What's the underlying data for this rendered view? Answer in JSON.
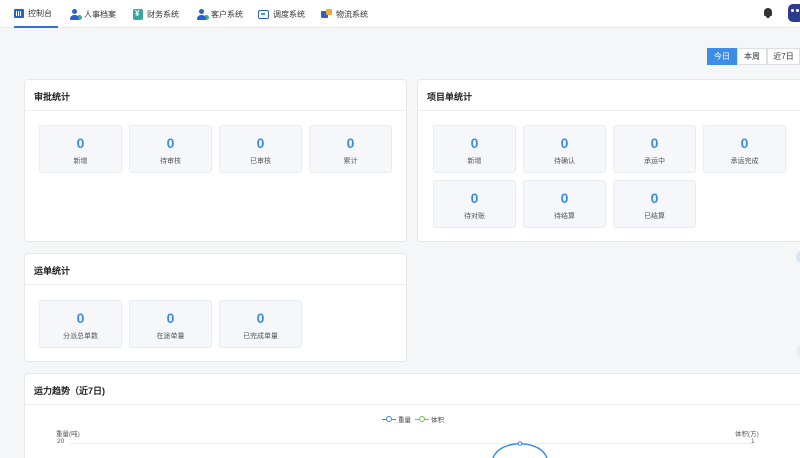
{
  "nav": {
    "items": [
      {
        "label": "控制台",
        "icon": "dashboard-icon"
      },
      {
        "label": "人事档案",
        "icon": "person-icon"
      },
      {
        "label": "财务系统",
        "icon": "finance-icon"
      },
      {
        "label": "客户系统",
        "icon": "customer-icon"
      },
      {
        "label": "调度系统",
        "icon": "monitor-icon"
      },
      {
        "label": "物流系统",
        "icon": "logistics-icon"
      }
    ],
    "active_index": 0,
    "accent": "#2f6fd6"
  },
  "date_range": {
    "options": [
      "今日",
      "本周",
      "近7日"
    ],
    "selected": "今日",
    "accent": "#3d8ce8"
  },
  "approval": {
    "title": "审批统计",
    "stats": [
      {
        "value": "0",
        "label": "新增"
      },
      {
        "value": "0",
        "label": "待审核"
      },
      {
        "value": "0",
        "label": "已审核"
      },
      {
        "value": "0",
        "label": "累计"
      }
    ]
  },
  "project": {
    "title": "项目单统计",
    "stats": [
      {
        "value": "0",
        "label": "新增"
      },
      {
        "value": "0",
        "label": "待确认"
      },
      {
        "value": "0",
        "label": "承运中"
      },
      {
        "value": "0",
        "label": "承运完成"
      },
      {
        "value": "0",
        "label": "待对账"
      },
      {
        "value": "0",
        "label": "待结算"
      },
      {
        "value": "0",
        "label": "已结算"
      }
    ]
  },
  "waybill": {
    "title": "运单统计",
    "stats": [
      {
        "value": "0",
        "label": "分派总单数"
      },
      {
        "value": "0",
        "label": "在途单量"
      },
      {
        "value": "0",
        "label": "已完成单量"
      }
    ]
  },
  "trend": {
    "title": "运力趋势（近7日)",
    "chart_data": {
      "type": "line",
      "series": [
        {
          "name": "重量",
          "color": "#3d8ce8"
        },
        {
          "name": "体积",
          "color": "#6cc24a"
        }
      ],
      "y_left": {
        "label": "重量(吨)",
        "top_tick": "20"
      },
      "y_right": {
        "label": "体积(方)",
        "top_tick": "1"
      }
    }
  }
}
